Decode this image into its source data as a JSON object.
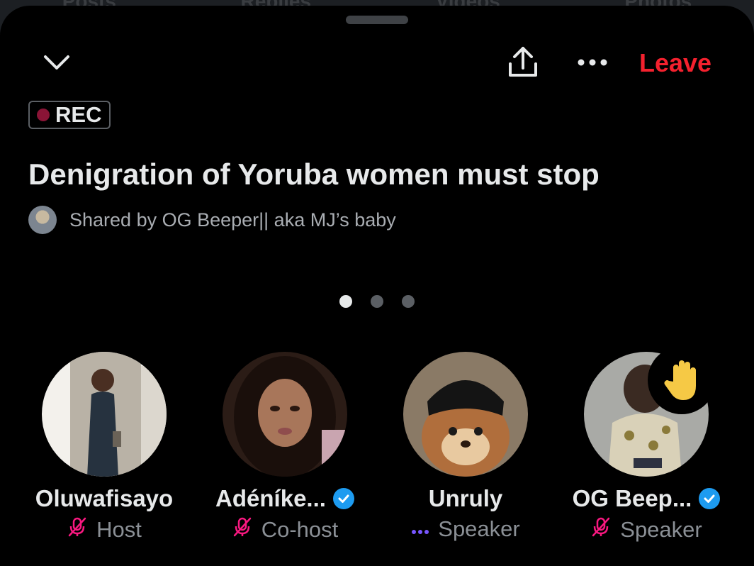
{
  "background_tabs": [
    "Posts",
    "Replies",
    "Videos",
    "Photos"
  ],
  "header": {
    "leave_label": "Leave",
    "leave_color": "#f4212e"
  },
  "icons": {
    "collapse": "chevron-down-icon",
    "share": "share-icon",
    "more": "more-icon",
    "raised_hand": "raised-hand-icon",
    "mic_off": "mic-off-icon",
    "speaking": "speaking-dots-icon",
    "verified": "verified-icon"
  },
  "space": {
    "rec_label": "REC",
    "title": "Denigration of Yoruba women must stop",
    "shared_by": "Shared by OG Beeper|| aka MJ’s baby"
  },
  "pagination": {
    "pages": 3,
    "current": 1
  },
  "speakers": [
    {
      "name": "Oluwafisayo",
      "role": "Host",
      "verified": false,
      "mic": "muted"
    },
    {
      "name": "Adéníke...",
      "role": "Co-host",
      "verified": true,
      "mic": "muted"
    },
    {
      "name": "Unruly",
      "role": "Speaker",
      "verified": false,
      "mic": "speaking"
    },
    {
      "name": "OG Beep...",
      "role": "Speaker",
      "verified": true,
      "mic": "muted",
      "hand_raised": true
    }
  ],
  "colors": {
    "accent_red": "#f4212e",
    "mic_muted": "#f91880",
    "speaking": "#7856ff",
    "verified_blue": "#1d9bf0",
    "rec_dot": "#8a1436"
  }
}
